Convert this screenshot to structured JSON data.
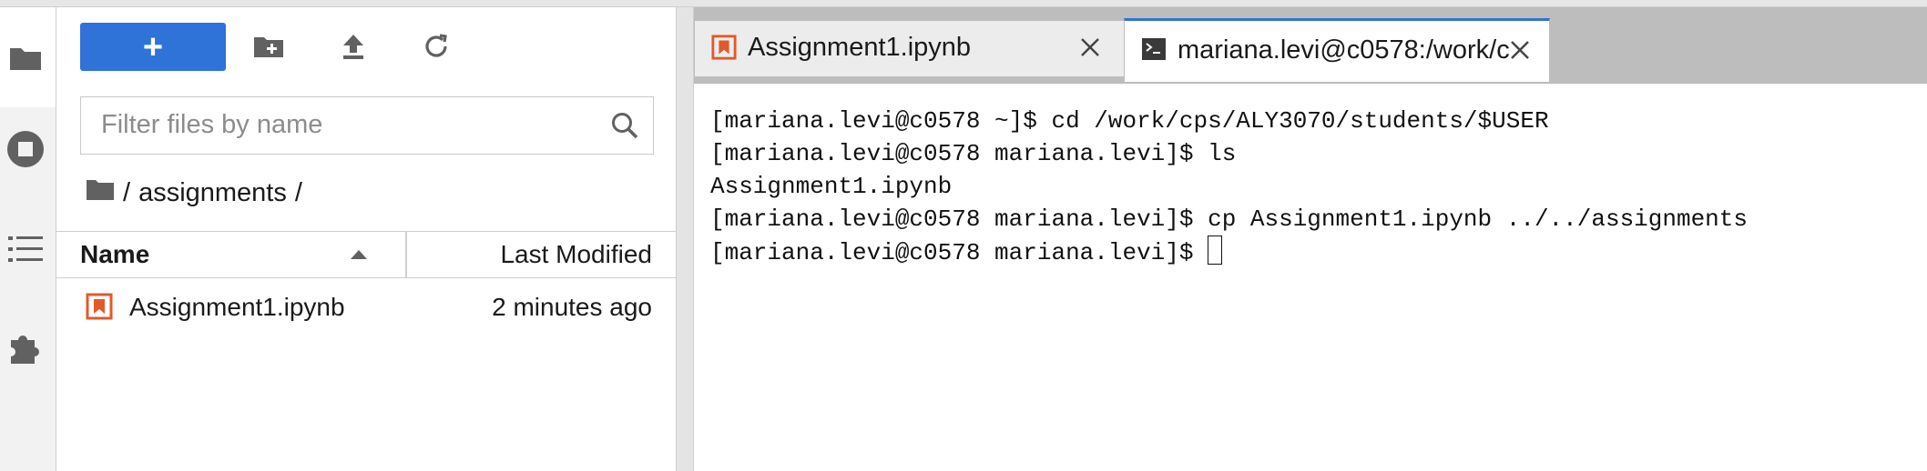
{
  "colors": {
    "accent": "#2f72d8",
    "notebook_icon": "#e05a2b"
  },
  "activity_bar": {
    "items": [
      {
        "name": "file-browser",
        "icon": "folder-icon"
      },
      {
        "name": "running",
        "icon": "stop-circle-icon"
      },
      {
        "name": "table-of-contents",
        "icon": "list-icon"
      },
      {
        "name": "extensions",
        "icon": "puzzle-icon"
      }
    ]
  },
  "file_browser": {
    "new_button_label": "+",
    "toolbar": {
      "new_folder_icon": "new-folder-icon",
      "upload_icon": "upload-icon",
      "refresh_icon": "refresh-icon"
    },
    "filter_placeholder": "Filter files by name",
    "filter_value": "",
    "breadcrumb": {
      "sep1": "/",
      "folder": "assignments",
      "sep2": "/"
    },
    "columns": {
      "name": "Name",
      "modified": "Last Modified"
    },
    "files": [
      {
        "name": "Assignment1.ipynb",
        "modified": "2 minutes ago",
        "icon": "notebook-icon"
      }
    ]
  },
  "tabs": [
    {
      "label": "Assignment1.ipynb",
      "icon": "notebook-icon",
      "active": false
    },
    {
      "label": "mariana.levi@c0578:/work/c",
      "icon": "terminal-icon",
      "active": true
    }
  ],
  "terminal": {
    "lines": [
      "[mariana.levi@c0578 ~]$ cd /work/cps/ALY3070/students/$USER",
      "[mariana.levi@c0578 mariana.levi]$ ls",
      "Assignment1.ipynb",
      "[mariana.levi@c0578 mariana.levi]$ cp Assignment1.ipynb ../../assignments",
      "[mariana.levi@c0578 mariana.levi]$ "
    ]
  }
}
